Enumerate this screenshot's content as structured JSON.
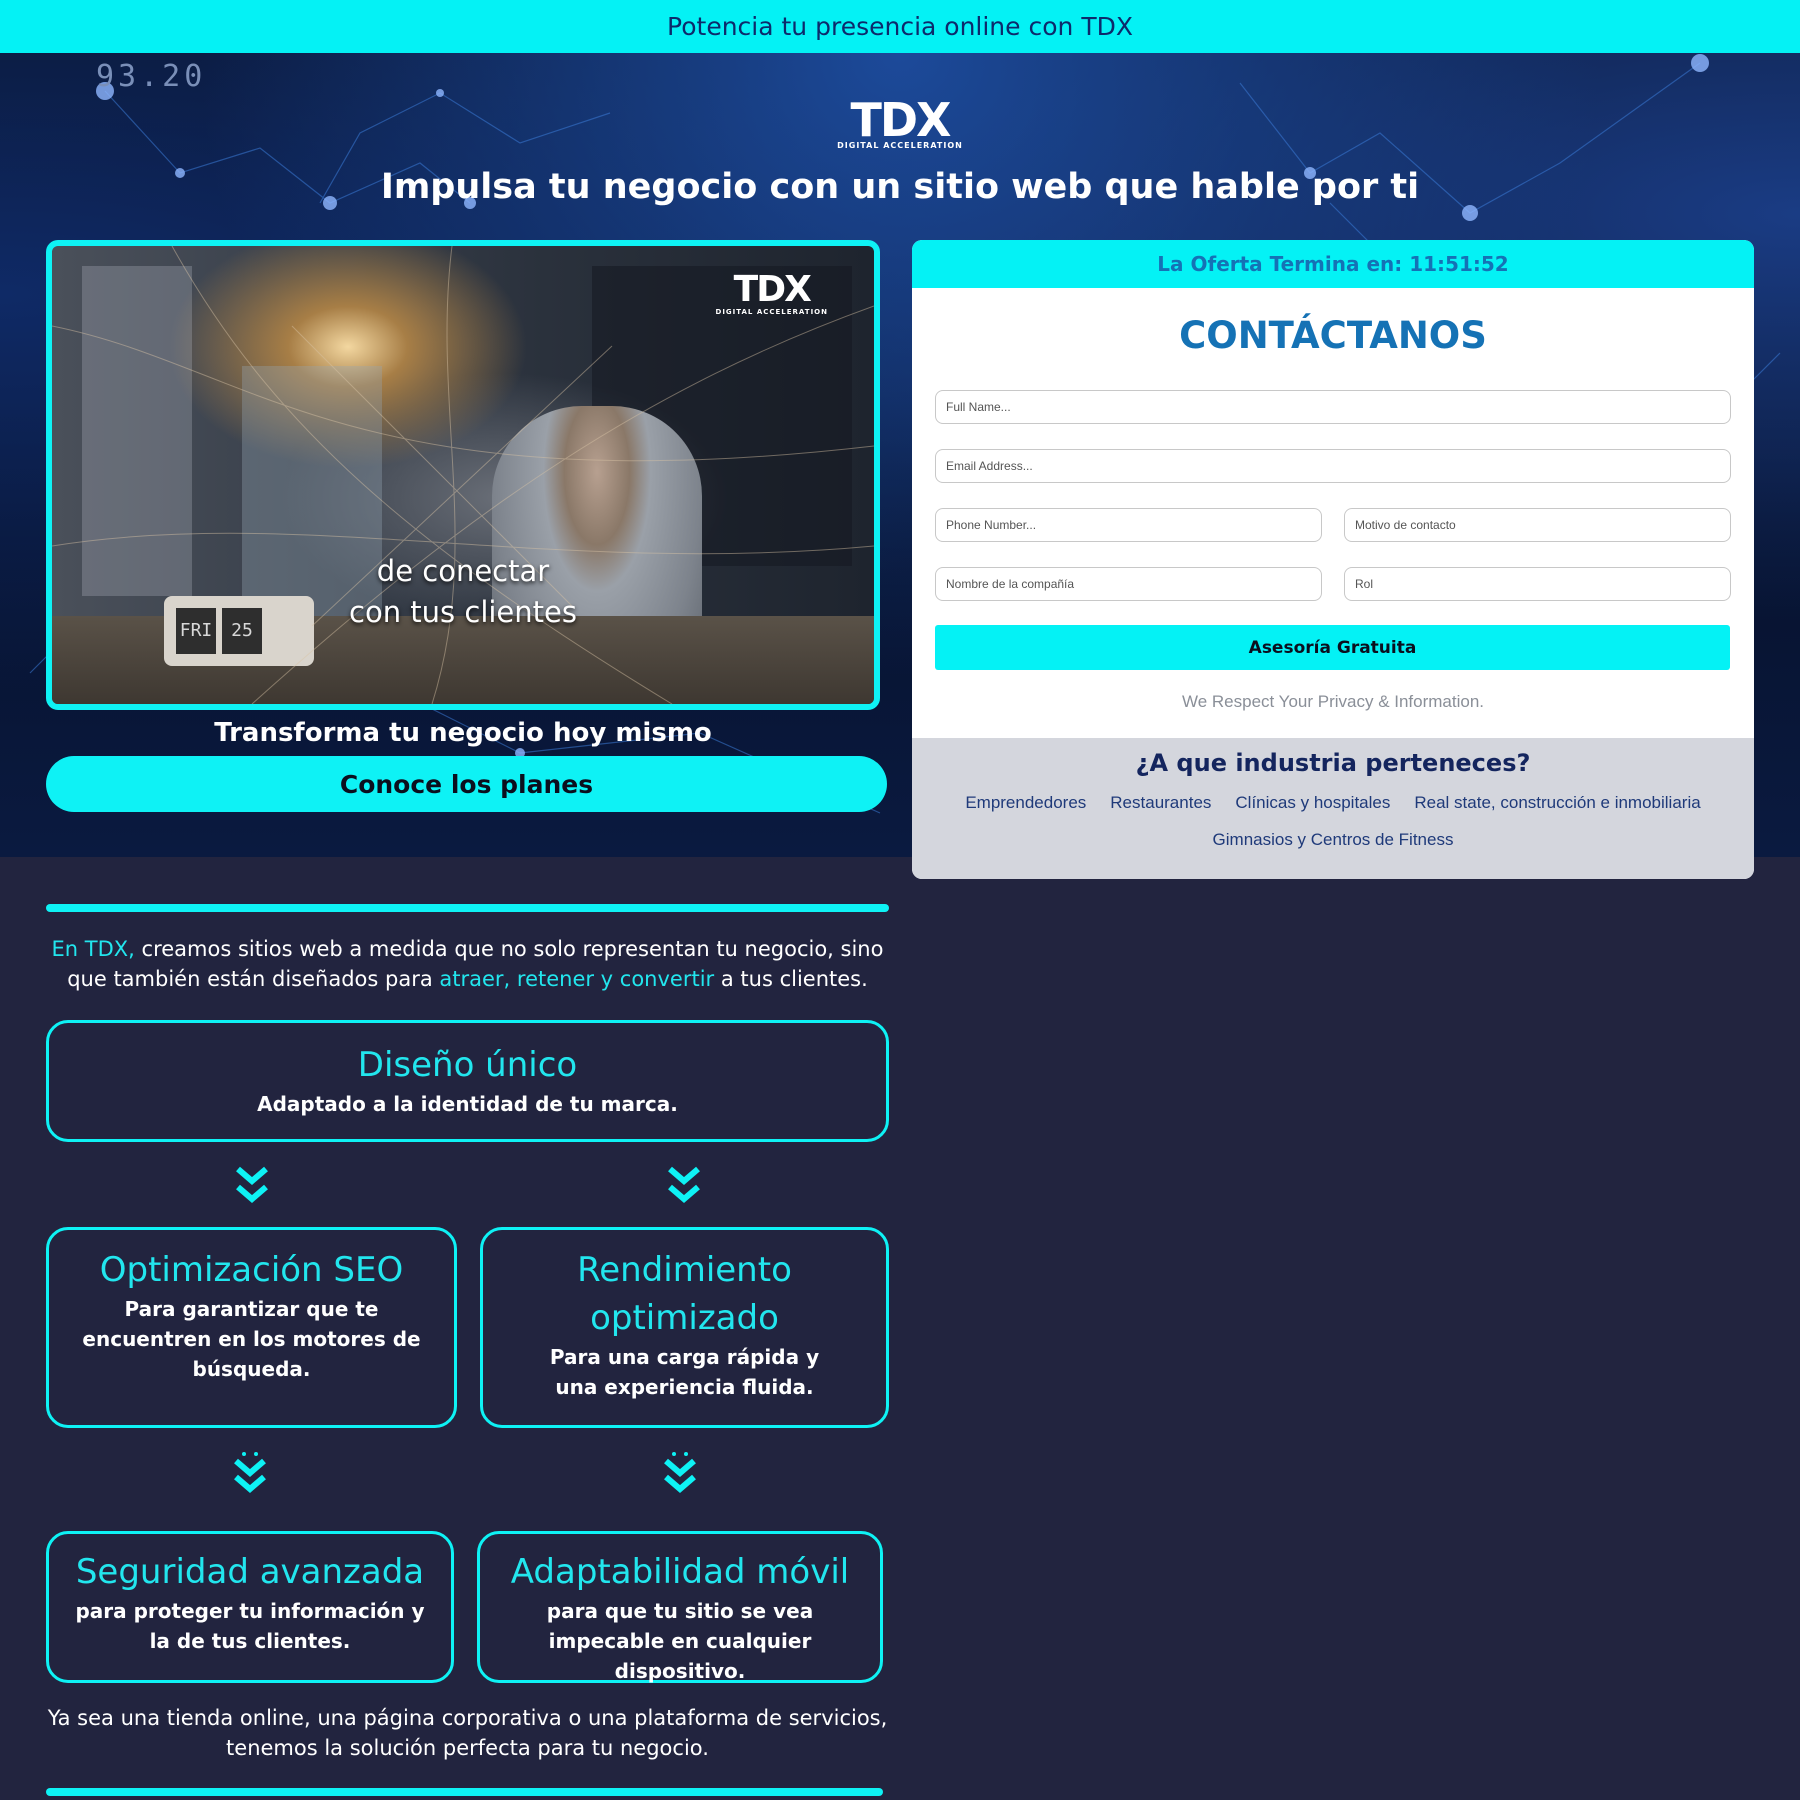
{
  "topbar": {
    "text": "Potencia tu presencia online con TDX"
  },
  "hero": {
    "readout": "93.20",
    "logo_word": "TDX",
    "logo_tag": "DIGITAL ACCELERATION",
    "title": "Impulsa tu negocio con un sitio web que hable por ti",
    "video": {
      "logo_word": "TDX",
      "logo_tag": "DIGITAL ACCELERATION",
      "caption_line1": "de conectar",
      "caption_line2": "con tus clientes",
      "clock_day": "FRI",
      "clock_date": "25"
    },
    "subtitle": "Transforma tu negocio hoy mismo",
    "cta_label": "Conoce los planes"
  },
  "form": {
    "offer_label": "La Oferta Termina en: 11:51:52",
    "title": "CONTÁCTANOS",
    "fields": {
      "full_name": "Full Name...",
      "email": "Email Address...",
      "phone": "Phone Number...",
      "motivo": "Motivo de contacto",
      "company": "Nombre de la compañía",
      "rol": "Rol"
    },
    "submit_label": "Asesoría Gratuita",
    "privacy": "We Respect Your Privacy & Information."
  },
  "industry": {
    "title": "¿A que industria perteneces?",
    "items": [
      "Emprendedores",
      "Restaurantes",
      "Clínicas y hospitales",
      "Real state, construcción e inmobiliaria",
      "Gimnasios y Centros de Fitness"
    ]
  },
  "intro": {
    "hl1": "En TDX,",
    "t1": " creamos sitios web a medida que no solo representan tu negocio, sino que también están diseñados para ",
    "hl2": "atraer, retener y convertir",
    "t2": " a tus clientes."
  },
  "features": [
    {
      "title": "Diseño único",
      "desc": "Adaptado a la identidad de tu marca."
    },
    {
      "title": "Optimización SEO",
      "desc": "Para garantizar que te encuentren en los motores de búsqueda."
    },
    {
      "title": "Rendimiento optimizado",
      "desc": "Para una carga rápida y una experiencia fluida."
    },
    {
      "title": "Seguridad avanzada",
      "desc": "para proteger tu información y la de tus clientes."
    },
    {
      "title": "Adaptabilidad móvil",
      "desc": "para que tu sitio se vea impecable en cualquier dispositivo."
    }
  ],
  "outro": "Ya sea una tienda online, una página corporativa o una plataforma de servicios, tenemos la solución perfecta para tu negocio.",
  "colors": {
    "accent": "#04f2f5",
    "navy": "#22243f",
    "form_blue": "#1572b5",
    "industry_bg": "#d4d6dd"
  },
  "icons": [
    "chevron-double-down-icon",
    "network-background",
    "tdx-logo"
  ]
}
